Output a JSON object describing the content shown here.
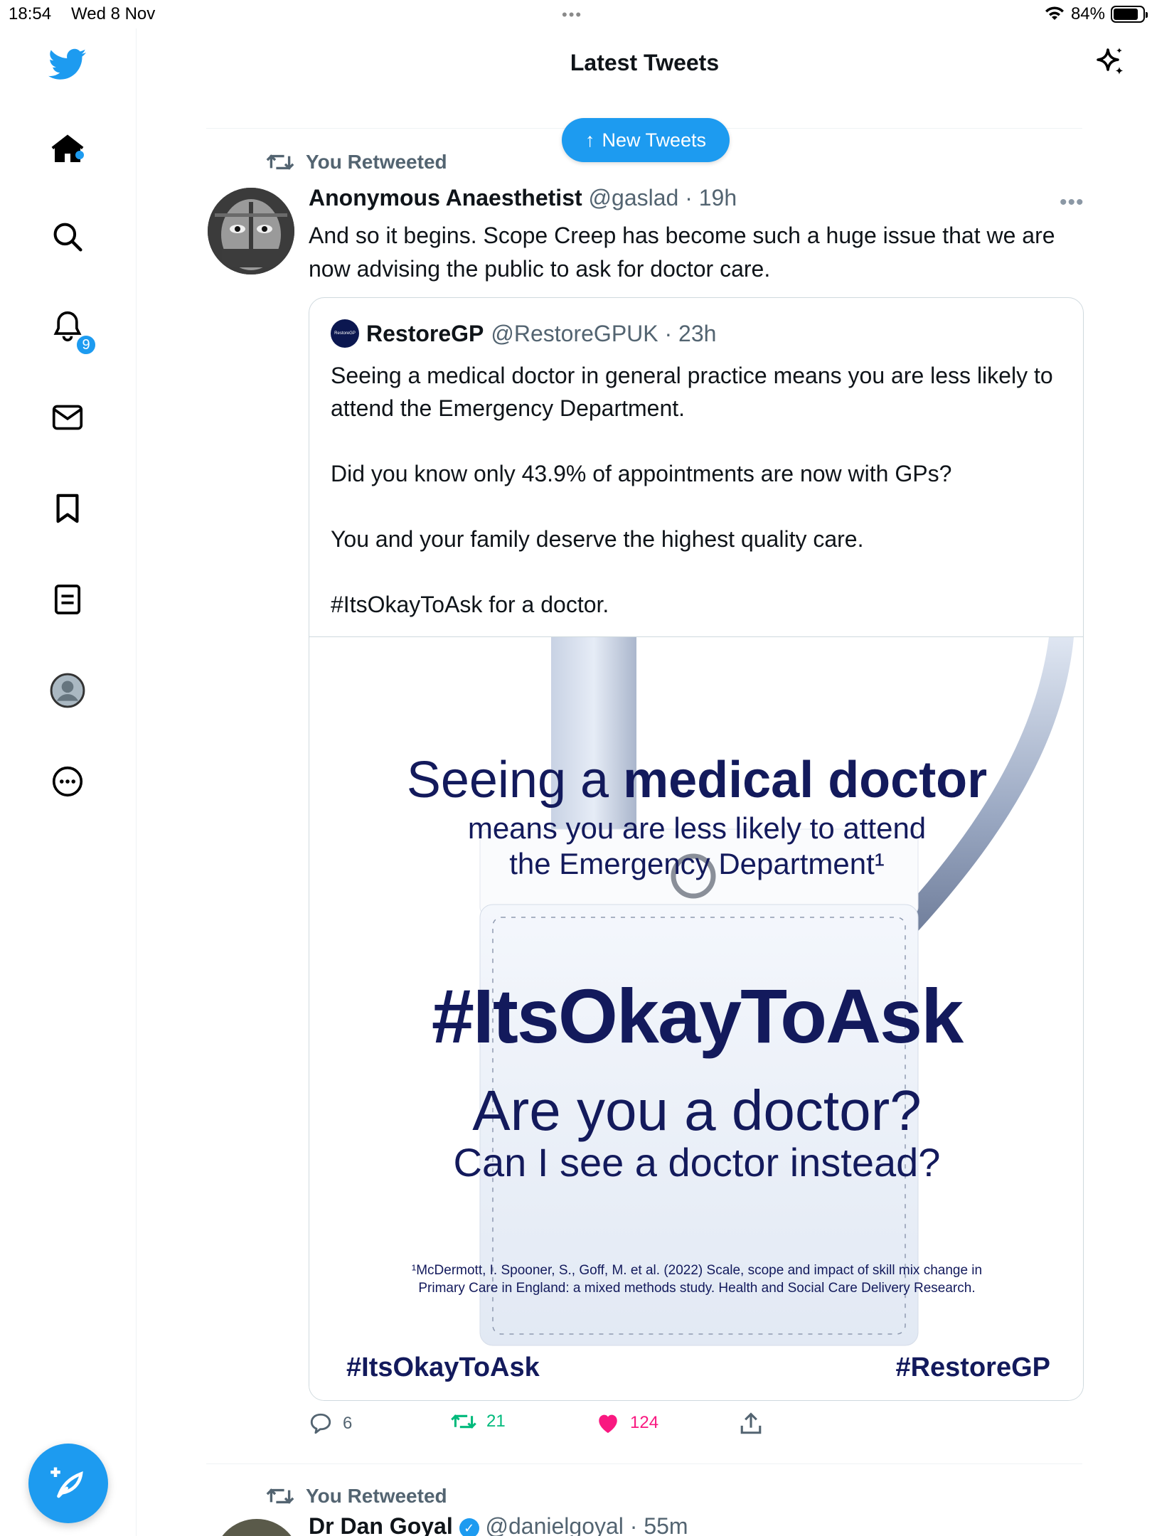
{
  "status_bar": {
    "time": "18:54",
    "date": "Wed 8 Nov",
    "battery": "84%",
    "battery_level": 0.84
  },
  "sidebar": {
    "items": [
      {
        "name": "twitter-logo-icon"
      },
      {
        "name": "home-icon"
      },
      {
        "name": "search-icon"
      },
      {
        "name": "notifications-icon",
        "badge": "9"
      },
      {
        "name": "messages-icon"
      },
      {
        "name": "bookmarks-icon"
      },
      {
        "name": "lists-icon"
      },
      {
        "name": "profile-icon"
      },
      {
        "name": "more-icon"
      }
    ],
    "compose_icon": "compose-tweet-icon"
  },
  "header": {
    "title": "Latest Tweets",
    "sparkle_icon": "sparkle-icon"
  },
  "new_tweets_pill": {
    "label": "New Tweets"
  },
  "tweet": {
    "retweet_label": "You Retweeted",
    "author_name": "Anonymous Anaesthetist",
    "author_meta": "@gaslad · 19h",
    "text": "And so it begins. Scope Creep has become such a huge issue that we are now advising the public to ask for doctor care.",
    "quote": {
      "author_name": "RestoreGP",
      "author_meta": "@RestoreGPUK · 23h",
      "logo_text": "RestoreGP",
      "text": "Seeing a medical doctor in general practice means you are less likely to attend the Emergency Department.\n\nDid you know only 43.9% of appointments are now with GPs?\n\nYou and your family deserve the highest quality care.\n\n#ItsOkayToAsk for a doctor.",
      "poster": {
        "line1_a": "Seeing a ",
        "line1_b": "medical doctor",
        "line2": "means you are less likely to attend",
        "line3": "the Emergency Department¹",
        "hashtag": "#ItsOkayToAsk",
        "question1": "Are you a doctor?",
        "question2": "Can I see a doctor instead?",
        "reference1": "¹McDermott, I. Spooner, S., Goff, M. et al. (2022) Scale, scope and impact of skill mix change in",
        "reference2": "Primary Care in England: a mixed methods study. Health and Social Care Delivery Research.",
        "footer_left": "#ItsOkayToAsk",
        "footer_right": "#RestoreGP"
      }
    },
    "actions": {
      "replies": "6",
      "retweets": "21",
      "likes": "124"
    },
    "colors": {
      "accent": "#1d9bf0",
      "retweet_green": "#00ba7c",
      "like_pink": "#f91880",
      "poster_navy": "#131a5c"
    }
  },
  "next_tweet": {
    "retweet_label": "You Retweeted",
    "author_name": "Dr Dan Goyal",
    "author_meta": "@danielgoyal · 55m"
  }
}
